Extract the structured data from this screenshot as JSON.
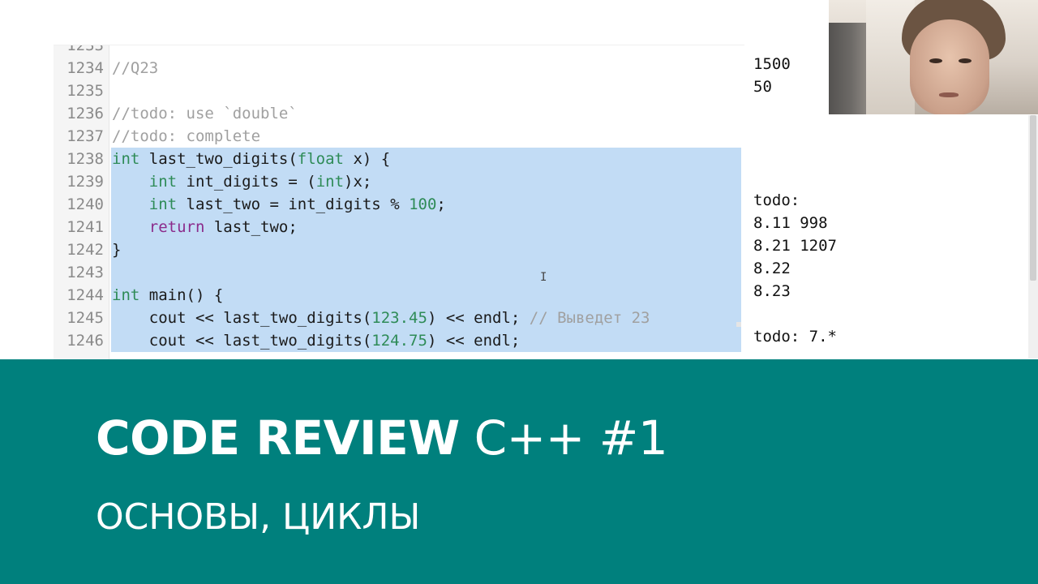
{
  "editor": {
    "partial_top_line_number": "1233",
    "lines": [
      {
        "number": "1234",
        "selected": false,
        "tokens": [
          {
            "t": "//Q23",
            "c": "cmt"
          }
        ]
      },
      {
        "number": "1235",
        "selected": false,
        "tokens": []
      },
      {
        "number": "1236",
        "selected": false,
        "tokens": [
          {
            "t": "//todo: use `double`",
            "c": "cmt"
          }
        ]
      },
      {
        "number": "1237",
        "selected": false,
        "tokens": [
          {
            "t": "//todo: complete",
            "c": "cmt"
          }
        ]
      },
      {
        "number": "1238",
        "selected": true,
        "tokens": [
          {
            "t": "int",
            "c": "kw-type"
          },
          {
            "t": " last_two_digits(",
            "c": ""
          },
          {
            "t": "float",
            "c": "kw-type"
          },
          {
            "t": " x) {",
            "c": ""
          }
        ]
      },
      {
        "number": "1239",
        "selected": true,
        "tokens": [
          {
            "t": "    ",
            "c": ""
          },
          {
            "t": "int",
            "c": "kw-type"
          },
          {
            "t": " int_digits = (",
            "c": ""
          },
          {
            "t": "int",
            "c": "kw-type"
          },
          {
            "t": ")x;",
            "c": ""
          }
        ]
      },
      {
        "number": "1240",
        "selected": true,
        "tokens": [
          {
            "t": "    ",
            "c": ""
          },
          {
            "t": "int",
            "c": "kw-type"
          },
          {
            "t": " last_two = int_digits % ",
            "c": ""
          },
          {
            "t": "100",
            "c": "num"
          },
          {
            "t": ";",
            "c": ""
          }
        ]
      },
      {
        "number": "1241",
        "selected": true,
        "tokens": [
          {
            "t": "    ",
            "c": ""
          },
          {
            "t": "return",
            "c": "kw-flow"
          },
          {
            "t": " last_two;",
            "c": ""
          }
        ]
      },
      {
        "number": "1242",
        "selected": true,
        "tokens": [
          {
            "t": "}",
            "c": ""
          }
        ]
      },
      {
        "number": "1243",
        "selected": true,
        "tokens": []
      },
      {
        "number": "1244",
        "selected": true,
        "tokens": [
          {
            "t": "int",
            "c": "kw-type"
          },
          {
            "t": " main() {",
            "c": ""
          }
        ]
      },
      {
        "number": "1245",
        "selected": true,
        "tokens": [
          {
            "t": "    cout << last_two_digits(",
            "c": ""
          },
          {
            "t": "123.45",
            "c": "num"
          },
          {
            "t": ") << endl; ",
            "c": ""
          },
          {
            "t": "// Выведет 23",
            "c": "cmt"
          }
        ]
      },
      {
        "number": "1246",
        "selected": true,
        "tokens": [
          {
            "t": "    cout << last_two_digits(",
            "c": ""
          },
          {
            "t": "124.75",
            "c": "num"
          },
          {
            "t": ") << endl;",
            "c": ""
          }
        ]
      }
    ]
  },
  "output": {
    "lines": [
      "1500",
      "50",
      "",
      "",
      "",
      "",
      "todo:",
      "8.11 998",
      "8.21 1207",
      "8.22",
      "8.23",
      "",
      "todo: 7.*"
    ]
  },
  "cursor_glyph": "I",
  "banner": {
    "title_bold": "CODE REVIEW",
    "title_light": "C++ #1",
    "subtitle": "ОСНОВЫ, ЦИКЛЫ"
  },
  "colors": {
    "banner_bg": "#00807d",
    "selection": "#c2dcf5",
    "keyword_type": "#2e8b57",
    "keyword_flow": "#8b2b8b",
    "comment": "#a0a0a0"
  }
}
